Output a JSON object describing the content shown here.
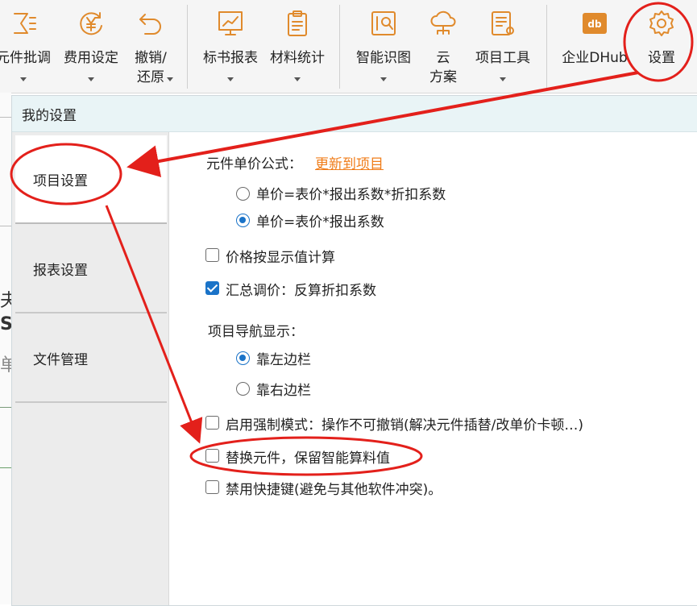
{
  "ribbon": {
    "buttons": [
      {
        "label": "元件批调",
        "icon": "sigma-list-icon"
      },
      {
        "label": "费用设定",
        "icon": "yen-cycle-icon"
      },
      {
        "label": "撤销/\n还原",
        "icon": "undo-icon"
      },
      {
        "label": "标书报表",
        "icon": "chart-board-icon"
      },
      {
        "label": "材料统计",
        "icon": "clipboard-icon"
      },
      {
        "label": "智能识图",
        "icon": "smart-image-icon"
      },
      {
        "label": "云\n方案",
        "icon": "cloud-icon"
      },
      {
        "label": "项目工具",
        "icon": "project-tool-icon"
      },
      {
        "label": "企业DHub",
        "icon": "dhub-logo-icon"
      },
      {
        "label": "设置",
        "icon": "gear-icon"
      }
    ]
  },
  "dialog": {
    "title": "我的设置",
    "tabs": [
      {
        "label": "项目设置",
        "active": true
      },
      {
        "label": "报表设置",
        "active": false
      },
      {
        "label": "文件管理",
        "active": false
      }
    ],
    "formula_label": "元件单价公式：",
    "formula_link": "更新到项目",
    "formula_options": [
      {
        "label": "单价=表价*报出系数*折扣系数",
        "selected": false
      },
      {
        "label": "单价=表价*报出系数",
        "selected": true
      }
    ],
    "price_display": {
      "label": "价格按显示值计算",
      "checked": false
    },
    "summary_adjust": {
      "label": "汇总调价：反算折扣系数",
      "checked": true
    },
    "nav_label": "项目导航显示：",
    "nav_options": [
      {
        "label": "靠左边栏",
        "selected": true
      },
      {
        "label": "靠右边栏",
        "selected": false
      }
    ],
    "force_mode": {
      "label": "启用强制模式：操作不可撤销(解决元件插替/改单价卡顿…)",
      "checked": false
    },
    "replace_keep": {
      "label": "替换元件，保留智能算料值",
      "checked": false
    },
    "disable_shortcut": {
      "label": "禁用快捷键(避免与其他软件冲突)。",
      "checked": false
    }
  },
  "background": {
    "glyphs": [
      "夫",
      "SV",
      "单"
    ]
  },
  "colors": {
    "accent": "#1a73c8",
    "link": "#f07d1a",
    "annotation": "#e3201b",
    "icon": "#e08a2c"
  }
}
